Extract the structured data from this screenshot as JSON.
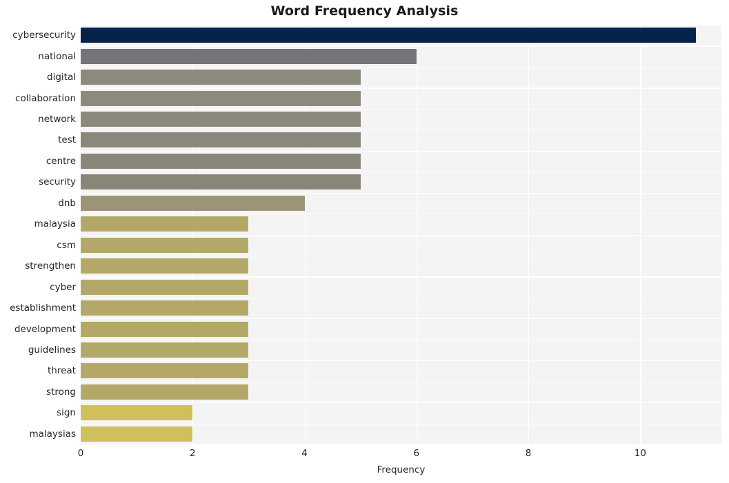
{
  "chart_data": {
    "type": "bar",
    "orientation": "horizontal",
    "title": "Word Frequency Analysis",
    "xlabel": "Frequency",
    "ylabel": "",
    "categories": [
      "cybersecurity",
      "national",
      "digital",
      "collaboration",
      "network",
      "test",
      "centre",
      "security",
      "dnb",
      "malaysia",
      "csm",
      "strengthen",
      "cyber",
      "establishment",
      "development",
      "guidelines",
      "threat",
      "strong",
      "sign",
      "malaysias"
    ],
    "values": [
      11,
      6,
      5,
      5,
      5,
      5,
      5,
      5,
      4,
      3,
      3,
      3,
      3,
      3,
      3,
      3,
      3,
      2,
      2
    ],
    "bars": [
      {
        "label": "cybersecurity",
        "value": 11,
        "color": "#06244b"
      },
      {
        "label": "national",
        "value": 6,
        "color": "#74747a"
      },
      {
        "label": "digital",
        "value": 5,
        "color": "#8b8a7d"
      },
      {
        "label": "collaboration",
        "value": 5,
        "color": "#8b8a7c"
      },
      {
        "label": "network",
        "value": 5,
        "color": "#8b897b"
      },
      {
        "label": "test",
        "value": 5,
        "color": "#8a887a"
      },
      {
        "label": "centre",
        "value": 5,
        "color": "#8a8779"
      },
      {
        "label": "security",
        "value": 5,
        "color": "#898678"
      },
      {
        "label": "dnb",
        "value": 4,
        "color": "#9c9476"
      },
      {
        "label": "malaysia",
        "value": 3,
        "color": "#b4a868"
      },
      {
        "label": "csm",
        "value": 3,
        "color": "#b4a868"
      },
      {
        "label": "strengthen",
        "value": 3,
        "color": "#b4a868"
      },
      {
        "label": "cyber",
        "value": 3,
        "color": "#b4a868"
      },
      {
        "label": "establishment",
        "value": 3,
        "color": "#b4a868"
      },
      {
        "label": "development",
        "value": 3,
        "color": "#b4a868"
      },
      {
        "label": "guidelines",
        "value": 3,
        "color": "#b4a868"
      },
      {
        "label": "threat",
        "value": 3,
        "color": "#b4a868"
      },
      {
        "label": "strong",
        "value": 3,
        "color": "#b4a868"
      },
      {
        "label": "sign",
        "value": 2,
        "color": "#d0c05c"
      },
      {
        "label": "malaysias",
        "value": 2,
        "color": "#d0c05c"
      }
    ],
    "xlim": [
      0,
      11.45
    ],
    "xticks": [
      0,
      2,
      4,
      6,
      8,
      10
    ],
    "xtick_labels": [
      "0",
      "2",
      "4",
      "6",
      "8",
      "10"
    ],
    "grid": true,
    "grid_color": "#ffffff",
    "plot_background": "#f4f4f5",
    "figure_background": "#ffffff",
    "legend": null,
    "axis_text_color": "#262626",
    "title_color": "#1a1a1a"
  }
}
